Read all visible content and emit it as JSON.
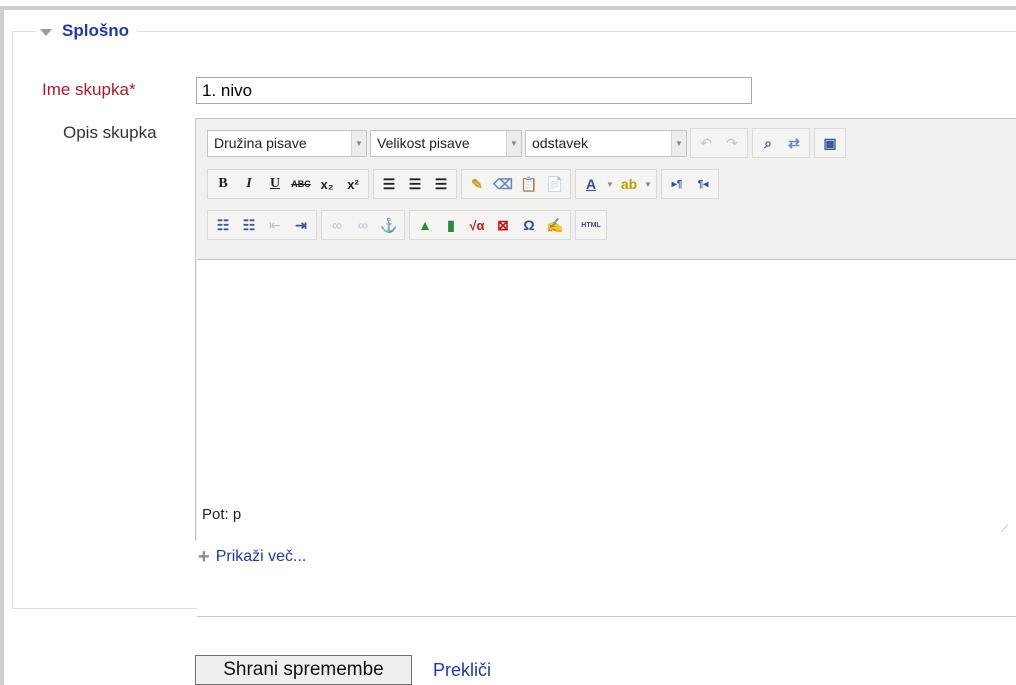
{
  "section": {
    "title": "Splošno"
  },
  "fields": {
    "name_label": "Ime skupka",
    "required_mark": "*",
    "name_value": "1. nivo",
    "description_label": "Opis skupka"
  },
  "editor": {
    "font_family": "Družina pisave",
    "font_size": "Velikost pisave",
    "format": "odstavek",
    "status_path": "Pot: p",
    "html_label": "HTML"
  },
  "more_link": "Prikaži več...",
  "buttons": {
    "save": "Shrani spremembe",
    "cancel": "Prekliči"
  }
}
